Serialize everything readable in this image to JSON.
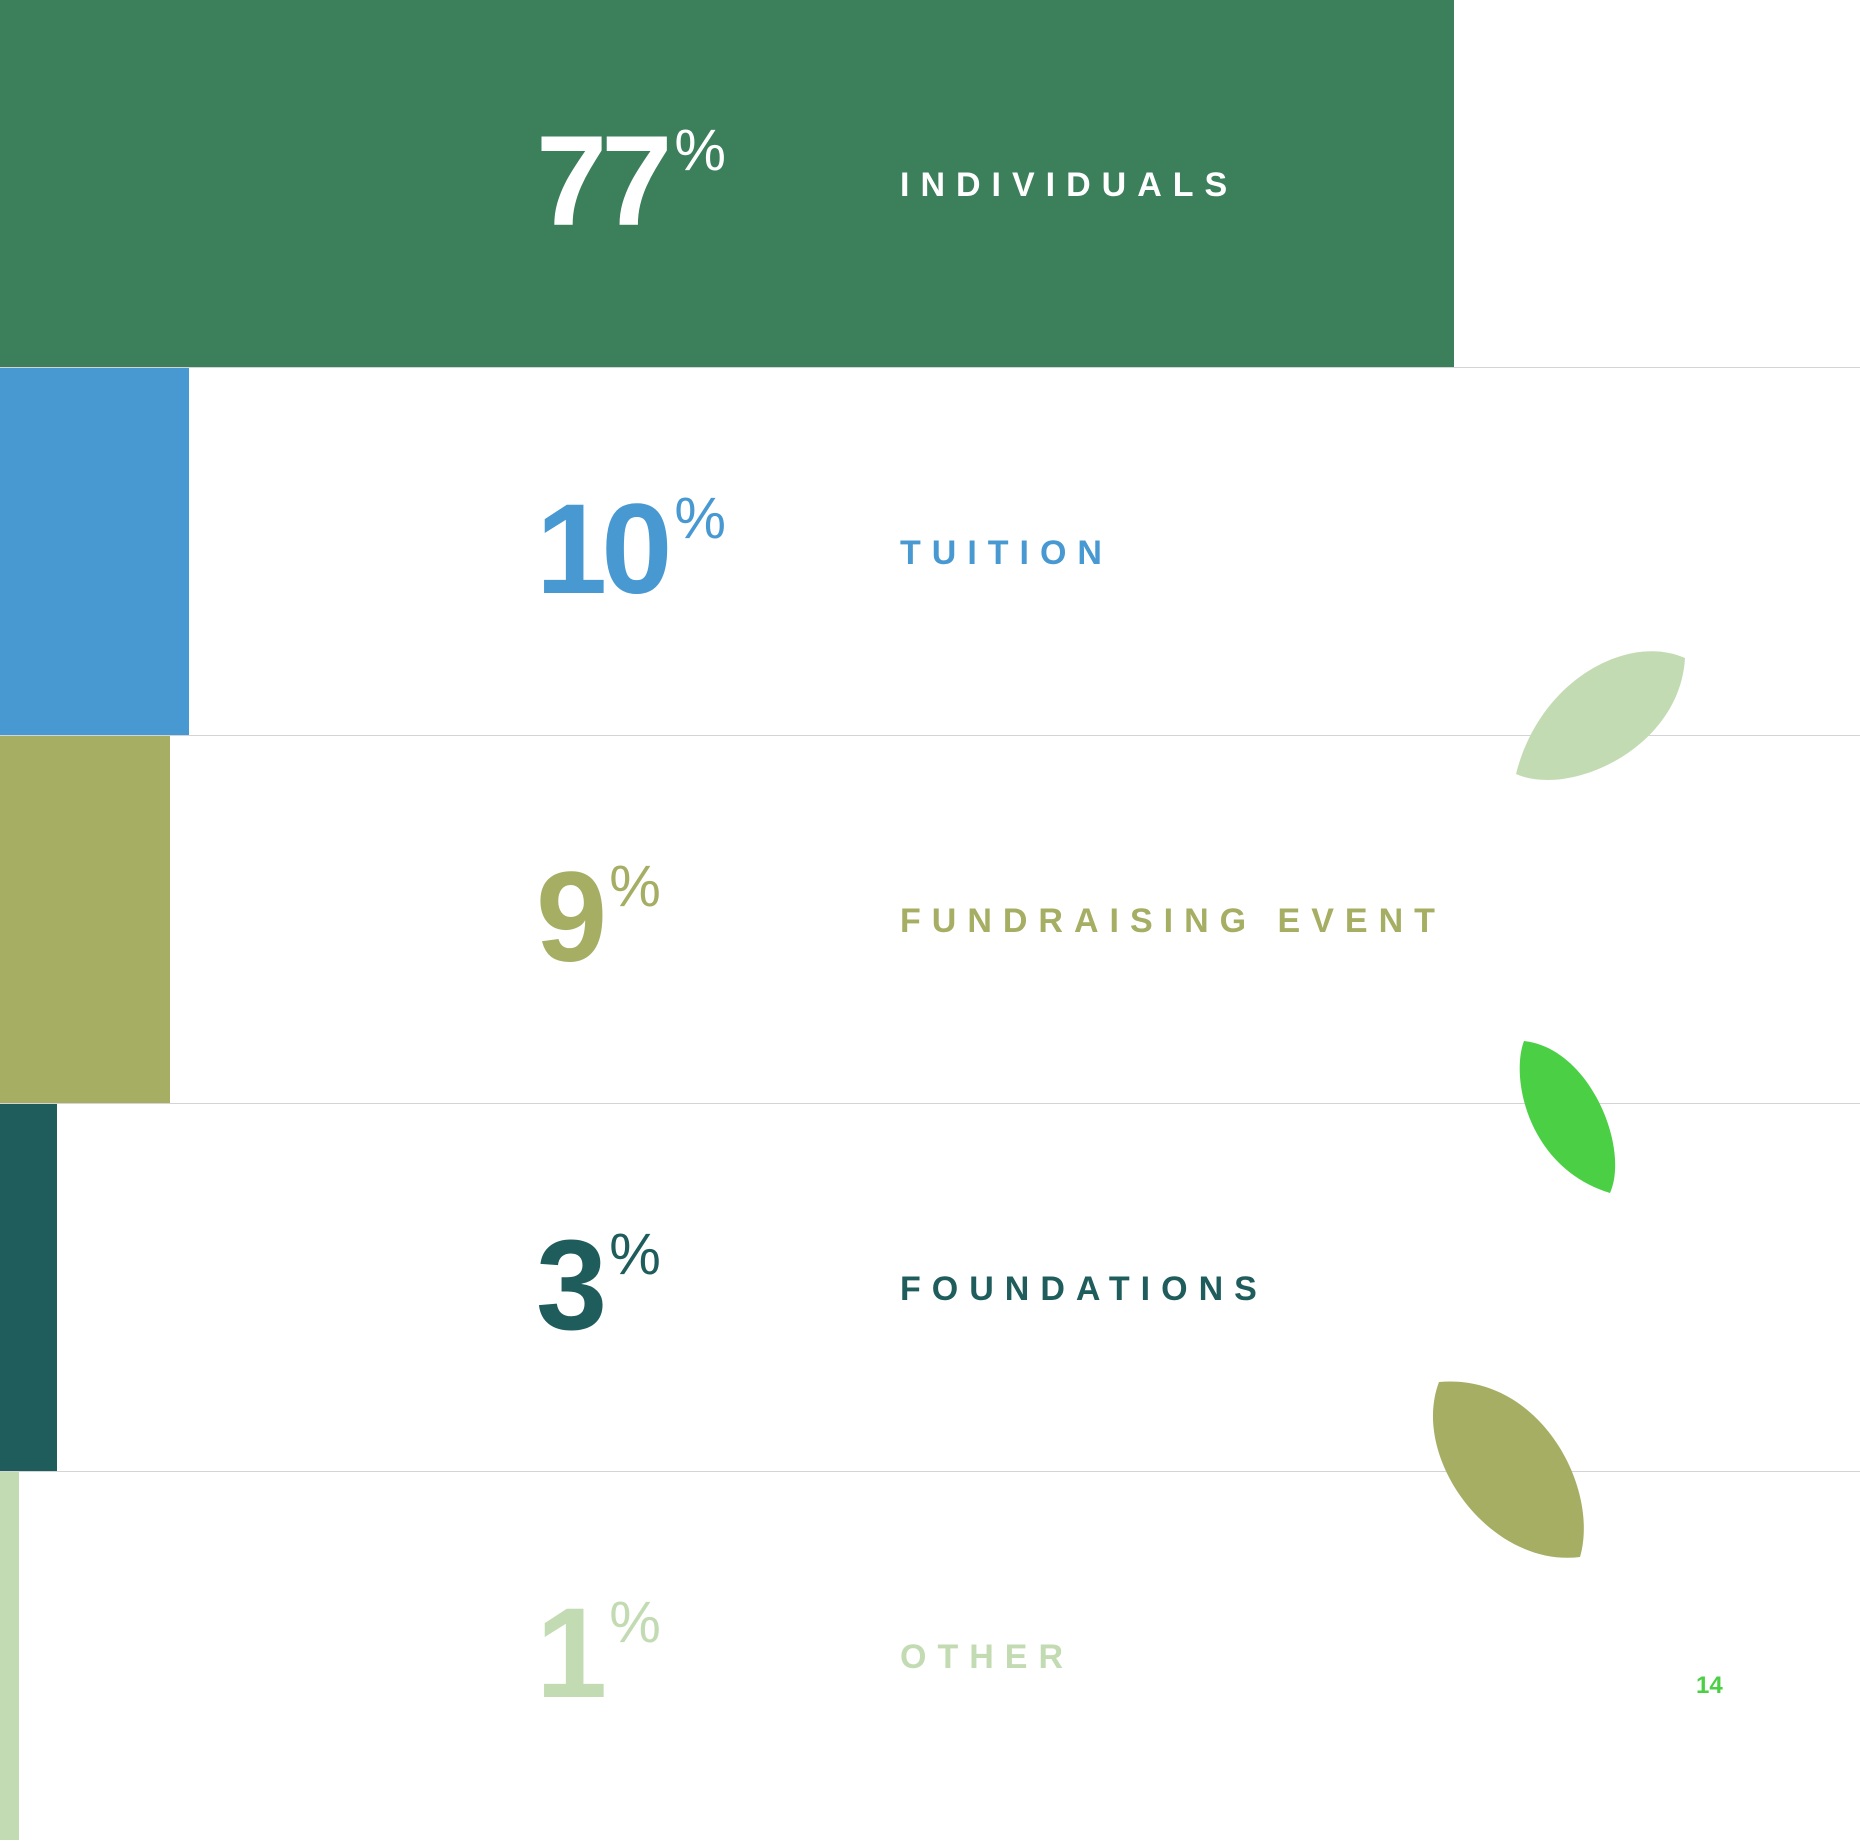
{
  "chart_data": {
    "type": "bar",
    "orientation": "horizontal",
    "categories": [
      "INDIVIDUALS",
      "TUITION",
      "FUNDRAISING EVENT",
      "FOUNDATIONS",
      "OTHER"
    ],
    "values": [
      77,
      10,
      9,
      3,
      1
    ],
    "value_suffix": "%",
    "colors": [
      "#3b7f5b",
      "#4899d1",
      "#a6ae64",
      "#1f5c5c",
      "#c3dbb2"
    ],
    "text_colors": [
      "#ffffff",
      "#4899d1",
      "#a6ae64",
      "#1f5c5c",
      "#c3dbb2"
    ],
    "xlim": [
      0,
      100
    ]
  },
  "decor": {
    "leaf_colors": [
      "#c3dbb2",
      "#4bcf45",
      "#a6ae64"
    ]
  },
  "page_number": "14"
}
